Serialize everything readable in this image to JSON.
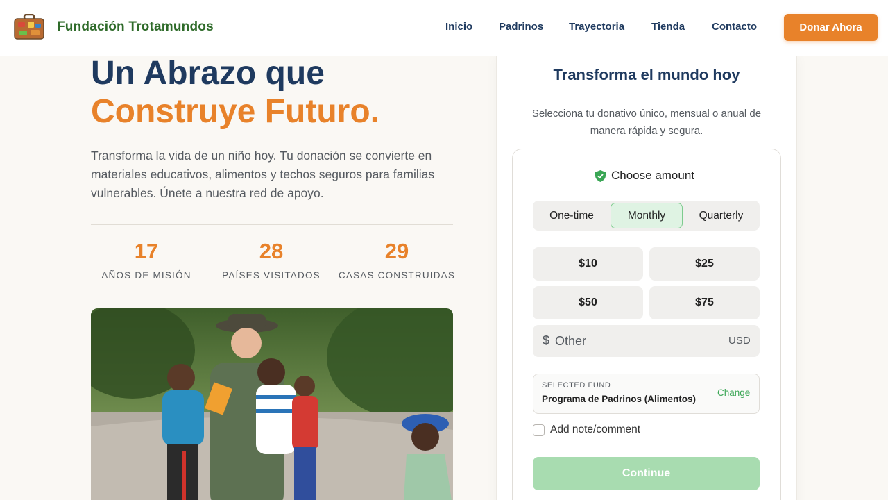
{
  "header": {
    "brand": "Fundación Trotamundos",
    "nav": [
      "Inicio",
      "Padrinos",
      "Trayectoria",
      "Tienda",
      "Contacto"
    ],
    "donate_label": "Donar Ahora",
    "icons": {
      "logo": "suitcase-logo-icon"
    },
    "colors": {
      "brand": "#2f6b2a",
      "accent": "#e8822a",
      "navy": "#1f3a5f"
    }
  },
  "hero": {
    "title_line1": "Un Abrazo que",
    "title_line2": "Construye Futuro.",
    "text": "Transforma la vida de un niño hoy. Tu donación se convierte en materiales educativos, alimentos y techos seguros para familias vulnerables. Únete a nuestra red de apoyo.",
    "stats": [
      {
        "value": "17",
        "label": "AÑOS DE MISIÓN"
      },
      {
        "value": "28",
        "label": "PAÍSES VISITADOS"
      },
      {
        "value": "29",
        "label": "CASAS CONSTRUIDAS"
      }
    ]
  },
  "donation": {
    "title": "Transforma el mundo hoy",
    "subtitle": "Selecciona tu donativo único, mensual o anual de manera rápida y segura.",
    "choose_label": "Choose amount",
    "frequencies": [
      "One-time",
      "Monthly",
      "Quarterly"
    ],
    "selected_frequency": "Monthly",
    "amounts": [
      "$10",
      "$25",
      "$50",
      "$75"
    ],
    "other": {
      "currency_symbol": "$",
      "placeholder": "Other",
      "currency": "USD"
    },
    "fund": {
      "label": "SELECTED FUND",
      "value": "Programa de Padrinos (Alimentos)",
      "change_label": "Change"
    },
    "note_label": "Add note/comment",
    "continue_label": "Continue",
    "colors": {
      "success": "#3aa655",
      "continue_disabled": "#a8dcb0"
    }
  }
}
